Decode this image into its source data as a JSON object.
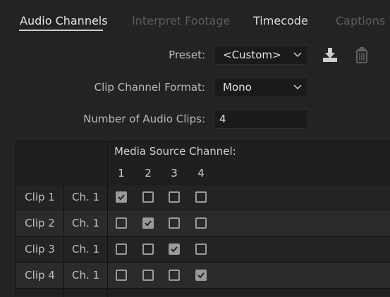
{
  "tabs": [
    {
      "label": "Audio Channels",
      "state": "active"
    },
    {
      "label": "Interpret Footage",
      "state": "dim"
    },
    {
      "label": "Timecode",
      "state": "normal"
    },
    {
      "label": "Captions",
      "state": "dim"
    }
  ],
  "preset": {
    "label": "Preset:",
    "value": "<Custom>",
    "icons": [
      "save-preset-icon",
      "trash-icon"
    ]
  },
  "clip_channel_format": {
    "label": "Clip Channel Format:",
    "value": "Mono"
  },
  "num_audio_clips": {
    "label": "Number of Audio Clips:",
    "value": "4"
  },
  "grid": {
    "media_source_label": "Media Source Channel:",
    "columns": [
      "1",
      "2",
      "3",
      "4"
    ],
    "rows": [
      {
        "clip": "Clip 1",
        "channel": "Ch. 1",
        "checked": [
          true,
          false,
          false,
          false
        ]
      },
      {
        "clip": "Clip 2",
        "channel": "Ch. 1",
        "checked": [
          false,
          true,
          false,
          false
        ]
      },
      {
        "clip": "Clip 3",
        "channel": "Ch. 1",
        "checked": [
          false,
          false,
          true,
          false
        ]
      },
      {
        "clip": "Clip 4",
        "channel": "Ch. 1",
        "checked": [
          false,
          false,
          false,
          true
        ]
      }
    ]
  },
  "colors": {
    "background": "#232323",
    "grid_band_alt": "#2b2b2b",
    "checkbox": "#9a9a9a"
  }
}
